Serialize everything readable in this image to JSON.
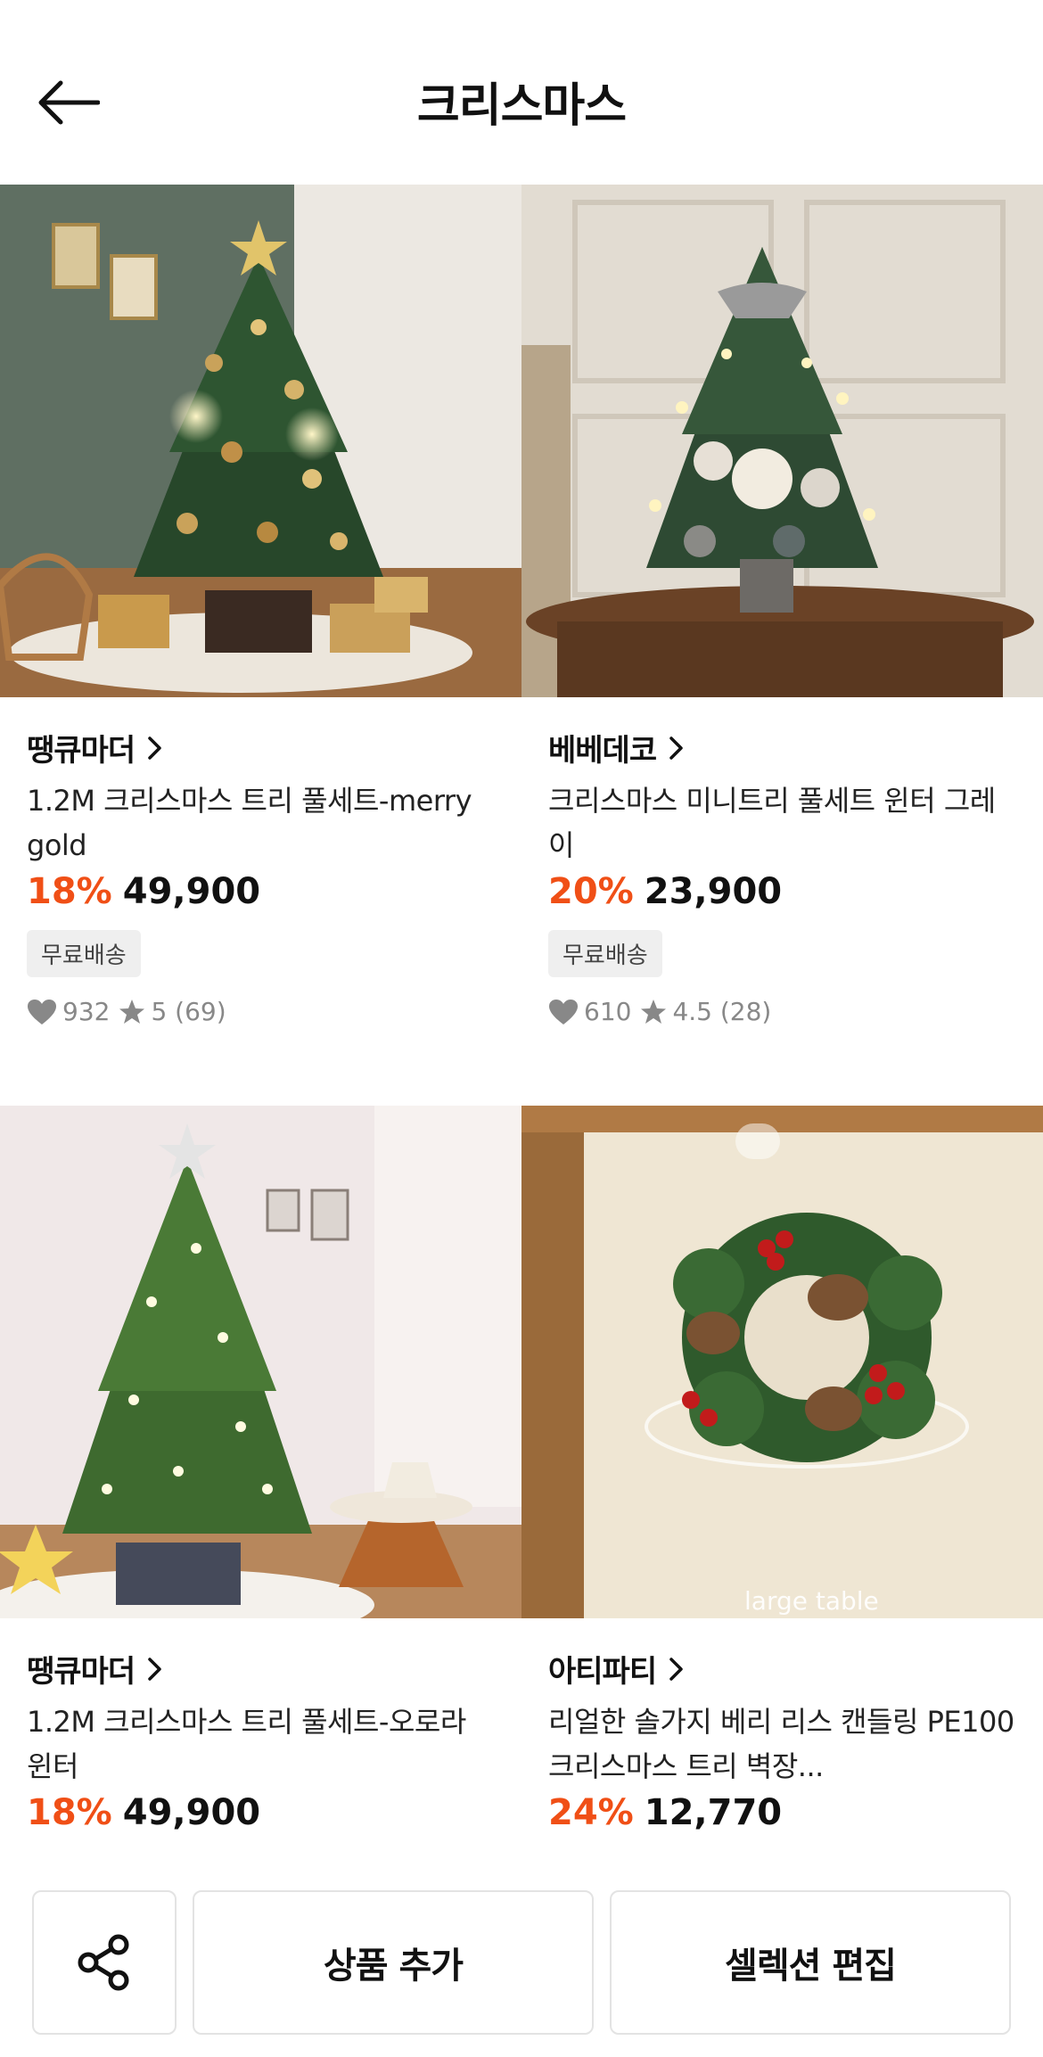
{
  "header": {
    "title": "크리스마스"
  },
  "products": [
    {
      "seller": "땡큐마더",
      "name": "1.2M 크리스마스 트리 풀세트-merry gold",
      "discount": "18%",
      "price": "49,900",
      "badge": "무료배송",
      "likes": "932",
      "rating": "5 (69)"
    },
    {
      "seller": "베베데코",
      "name": "크리스마스 미니트리 풀세트 윈터 그레이",
      "discount": "20%",
      "price": "23,900",
      "badge": "무료배송",
      "likes": "610",
      "rating": "4.5 (28)"
    },
    {
      "seller": "땡큐마더",
      "name": "1.2M 크리스마스 트리 풀세트-오로라 윈터",
      "discount": "18%",
      "price": "49,900"
    },
    {
      "seller": "아티파티",
      "name": "리얼한 솔가지 베리 리스 캔들링 PE100 크리스마스 트리 벽장...",
      "discount": "24%",
      "price": "12,770",
      "image_text": "large table"
    }
  ],
  "bottom": {
    "add_label": "상품 추가",
    "edit_label": "셀렉션 편집"
  }
}
